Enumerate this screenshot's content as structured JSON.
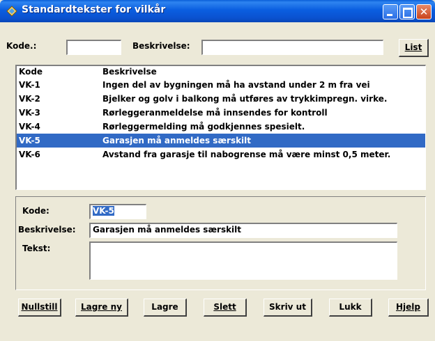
{
  "window": {
    "title": "Standardtekster for vilkår"
  },
  "search": {
    "kode_label": "Kode.:",
    "kode_value": "",
    "beskrivelse_label": "Beskrivelse:",
    "beskrivelse_value": "",
    "list_button": "List"
  },
  "list": {
    "headers": {
      "code": "Kode",
      "description": "Beskrivelse"
    },
    "rows": [
      {
        "code": "VK-1",
        "description": "Ingen del av bygningen må ha avstand under 2 m fra vei"
      },
      {
        "code": "VK-2",
        "description": "Bjelker og golv i balkong må utføres av trykkimpregn. virke."
      },
      {
        "code": "VK-3",
        "description": "Rørleggeranmeldelse må innsendes for kontroll"
      },
      {
        "code": "VK-4",
        "description": "Rørleggermelding må godkjennes spesielt."
      },
      {
        "code": "VK-5",
        "description": "Garasjen må anmeldes særskilt"
      },
      {
        "code": "VK-6",
        "description": "Avstand fra garasje til nabogrense må være minst 0,5 meter."
      }
    ],
    "selected_index": 4
  },
  "detail": {
    "kode_label": "Kode:",
    "kode_value": "VK-5",
    "beskrivelse_label": "Beskrivelse:",
    "beskrivelse_value": "Garasjen må anmeldes særskilt",
    "tekst_label": "Tekst:",
    "tekst_value": ""
  },
  "buttons": {
    "nullstill": "Nullstill",
    "lagre_ny": "Lagre ny",
    "lagre": "Lagre",
    "slett": "Slett",
    "skriv_ut": "Skriv ut",
    "lukk": "Lukk",
    "hjelp": "Hjelp"
  },
  "colors": {
    "selection": "#316ac5",
    "face": "#ece9d8",
    "titlebar": "#0a5ee0"
  }
}
